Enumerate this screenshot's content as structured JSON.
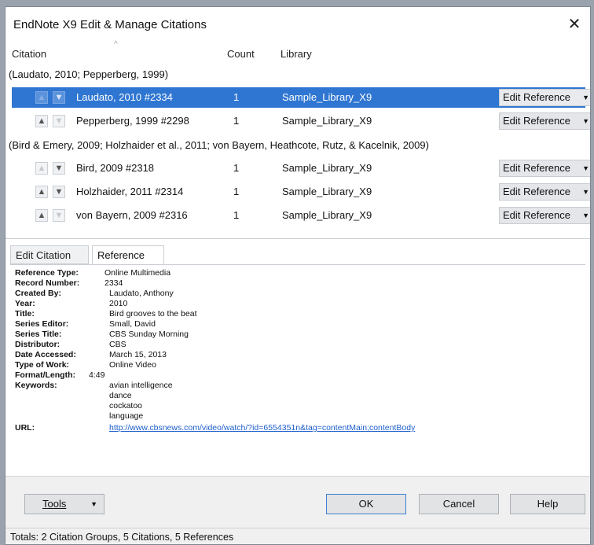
{
  "window": {
    "title": "EndNote X9 Edit & Manage Citations",
    "close_glyph": "✕"
  },
  "columns": {
    "citation": "Citation",
    "count": "Count",
    "library": "Library",
    "sort_glyph": "^"
  },
  "groups": [
    {
      "label": "(Laudato, 2010; Pepperberg, 1999)",
      "rows": [
        {
          "citation": "Laudato, 2010 #2334",
          "count": "1",
          "library": "Sample_Library_X9",
          "action": "Edit Reference",
          "selected": true
        },
        {
          "citation": "Pepperberg, 1999 #2298",
          "count": "1",
          "library": "Sample_Library_X9",
          "action": "Edit Reference",
          "selected": false
        }
      ]
    },
    {
      "label": "(Bird & Emery, 2009; Holzhaider et al., 2011; von Bayern, Heathcote, Rutz, & Kacelnik, 2009)",
      "rows": [
        {
          "citation": "Bird, 2009 #2318",
          "count": "1",
          "library": "Sample_Library_X9",
          "action": "Edit Reference",
          "selected": false
        },
        {
          "citation": "Holzhaider, 2011 #2314",
          "count": "1",
          "library": "Sample_Library_X9",
          "action": "Edit Reference",
          "selected": false
        },
        {
          "citation": "von Bayern, 2009 #2316",
          "count": "1",
          "library": "Sample_Library_X9",
          "action": "Edit Reference",
          "selected": false
        }
      ]
    }
  ],
  "icons": {
    "up": "up-arrow-icon",
    "down": "down-arrow-icon",
    "dropdown": "chevron-down-icon"
  },
  "tabs": {
    "edit_citation": "Edit Citation",
    "reference": "Reference"
  },
  "reference": {
    "fields": [
      {
        "label": "Reference Type:",
        "value": "Online Multimedia"
      },
      {
        "label": "Record Number:",
        "value": "2334"
      },
      {
        "label": "Created By:",
        "value": "Laudato, Anthony"
      },
      {
        "label": "Year:",
        "value": "2010"
      },
      {
        "label": "Title:",
        "value": "Bird grooves to the beat"
      },
      {
        "label": "Series Editor:",
        "value": "Small, David"
      },
      {
        "label": "Series Title:",
        "value": "CBS Sunday Morning"
      },
      {
        "label": "Distributor:",
        "value": "CBS"
      },
      {
        "label": "Date Accessed:",
        "value": "March 15, 2013"
      },
      {
        "label": "Type of Work:",
        "value": "Online Video"
      },
      {
        "label": "Format/Length:",
        "value": "4:49"
      }
    ],
    "keywords_label": "Keywords:",
    "keywords": [
      "avian intelligence",
      "dance",
      "cockatoo",
      "language"
    ],
    "url_label": "URL:",
    "url": "http://www.cbsnews.com/video/watch/?id=6554351n&tag=contentMain;contentBody"
  },
  "buttons": {
    "tools": "Tools",
    "ok": "OK",
    "cancel": "Cancel",
    "help": "Help"
  },
  "status": "Totals: 2 Citation Groups, 5 Citations, 5 References",
  "colors": {
    "selection": "#2f76d2",
    "link": "#1f5fcc"
  }
}
